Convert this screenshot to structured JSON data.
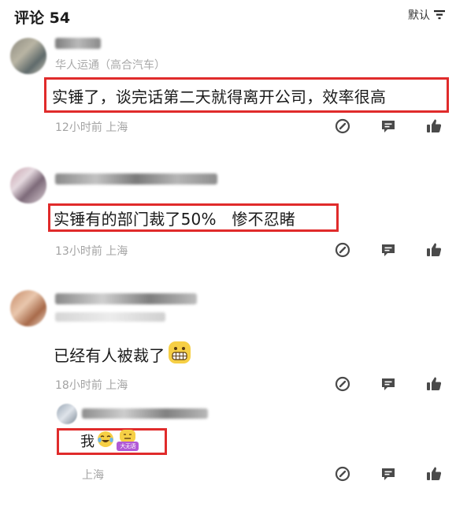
{
  "header": {
    "title": "评论 54",
    "sort_label": "默认"
  },
  "comments": [
    {
      "subname": "华人运通（高合汽车）",
      "text": "实锤了，谈完话第二天就得离开公司，效率很高",
      "meta": "12小时前 上海"
    },
    {
      "text": "实锤有的部门裁了50%   惨不忍睹",
      "meta": "13小时前 上海"
    },
    {
      "text": "已经有人被裁了",
      "meta": "18小时前 上海",
      "reply": {
        "text": "我",
        "sticker_label": "大无语",
        "meta": "上海"
      }
    }
  ],
  "icons": {
    "sort": "filter-sort-icon",
    "edit": "edit-icon",
    "comment": "comment-icon",
    "like": "thumbs-up-icon"
  },
  "colors": {
    "highlight": "#e02b2b",
    "icon": "#4a4a4a",
    "meta": "#a3a3a3"
  }
}
